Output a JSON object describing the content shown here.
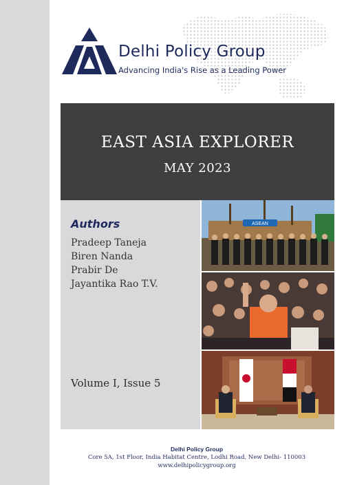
{
  "org": {
    "name": "Delhi Policy Group",
    "tagline": "Advancing India's Rise as a Leading Power"
  },
  "banner": {
    "title": "EAST ASIA EXPLORER",
    "date": "MAY 2023"
  },
  "authors": {
    "heading": "Authors",
    "names": [
      "Pradeep Taneja",
      "Biren Nanda",
      "Prabir De",
      "Jayantika Rao T.V."
    ]
  },
  "volume": "Volume I, Issue 5",
  "photo_captions": {
    "asean_banner": "ASEAN"
  },
  "footer": {
    "org": "Delhi Policy Group",
    "address": "Core 5A, 1st Floor, India Habitat Centre, Lodhi Road, New Delhi- 110003",
    "website": "www.delhipolicygroup.org"
  },
  "colors": {
    "brand_navy": "#1f2a5c",
    "banner_gray": "#3e3e3f",
    "panel_gray": "#d9d9db"
  }
}
